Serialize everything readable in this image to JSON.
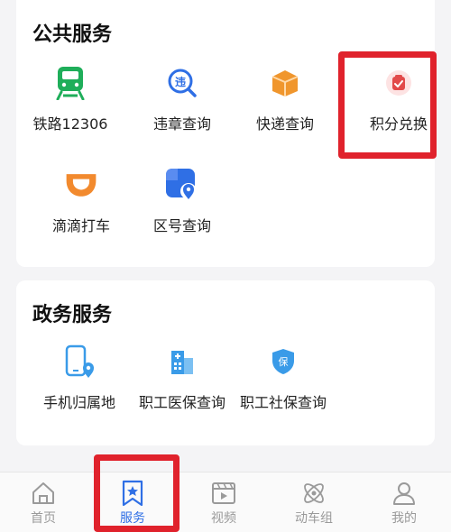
{
  "public_services": {
    "title": "公共服务",
    "items": [
      {
        "label": "铁路12306",
        "icon": "train-icon",
        "color": "#1fae5a"
      },
      {
        "label": "违章查询",
        "icon": "traffic-violation-icon",
        "color": "#2f6fe5"
      },
      {
        "label": "快递查询",
        "icon": "package-icon",
        "color": "#f0962d"
      },
      {
        "label": "积分兑换",
        "icon": "points-exchange-icon",
        "color": "#e24a4a"
      },
      {
        "label": "滴滴打车",
        "icon": "didi-icon",
        "color": "#f28a2e"
      },
      {
        "label": "区号查询",
        "icon": "area-code-icon",
        "color": "#2f6fe5"
      }
    ]
  },
  "gov_services": {
    "title": "政务服务",
    "items": [
      {
        "label": "手机归属地",
        "icon": "phone-location-icon",
        "color": "#3a9be8"
      },
      {
        "label": "职工医保查询",
        "icon": "medical-insurance-icon",
        "color": "#3a9be8"
      },
      {
        "label": "职工社保查询",
        "icon": "social-security-icon",
        "color": "#3a9be8"
      }
    ]
  },
  "tabbar": {
    "items": [
      {
        "label": "首页",
        "icon": "home-icon"
      },
      {
        "label": "服务",
        "icon": "service-bookmark-icon",
        "active": true
      },
      {
        "label": "视频",
        "icon": "video-icon"
      },
      {
        "label": "动车组",
        "icon": "atom-icon"
      },
      {
        "label": "我的",
        "icon": "user-icon"
      }
    ],
    "active_color": "#2f6fe5",
    "inactive_color": "#9a9a9a"
  },
  "highlight_color": "#e0222c"
}
